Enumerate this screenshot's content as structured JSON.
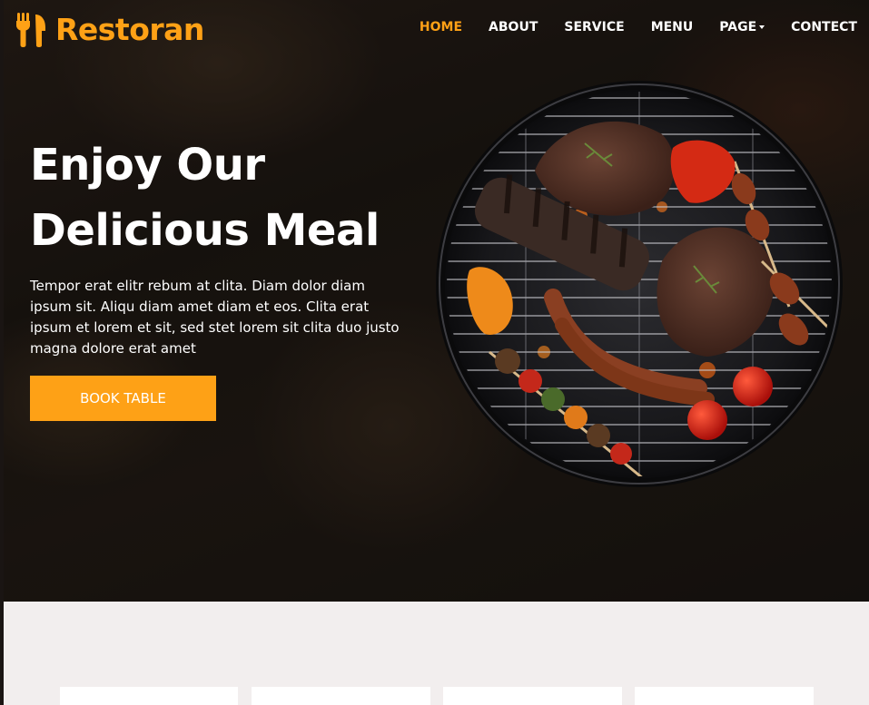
{
  "brand": {
    "name": "Restoran",
    "icon": "utensils-icon"
  },
  "nav": {
    "items": [
      {
        "label": "HOME",
        "active": true
      },
      {
        "label": "ABOUT",
        "active": false
      },
      {
        "label": "SERVICE",
        "active": false
      },
      {
        "label": "MENU",
        "active": false
      },
      {
        "label": "PAGE",
        "active": false,
        "dropdown": true
      },
      {
        "label": "CONTECT",
        "active": false
      }
    ]
  },
  "hero": {
    "title_line1": "Enjoy Our",
    "title_line2": "Delicious Meal",
    "text": "Tempor erat elitr rebum at clita. Diam dolor diam ipsum sit. Aliqu diam amet diam et eos. Clita erat ipsum et lorem et sit, sed stet lorem sit clita duo justo magna dolore erat amet",
    "button_label": "BOOK TABLE",
    "image": "bbq-grill-image"
  },
  "colors": {
    "accent": "#fea116",
    "dark": "#0f172b",
    "section_bg": "#f2eeee"
  }
}
